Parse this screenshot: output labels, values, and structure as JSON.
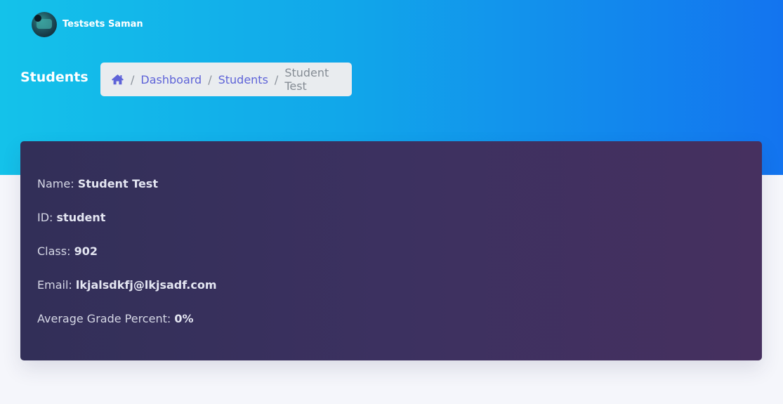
{
  "user": {
    "name": "Testsets Saman"
  },
  "page": {
    "title": "Students"
  },
  "breadcrumb": {
    "home_icon": "home-icon",
    "items": [
      {
        "label": "Dashboard"
      },
      {
        "label": "Students"
      }
    ],
    "current": "Student Test",
    "separator": "/"
  },
  "student": {
    "fields": [
      {
        "label": "Name:",
        "value": "Student Test"
      },
      {
        "label": "ID:",
        "value": "student"
      },
      {
        "label": "Class:",
        "value": "902"
      },
      {
        "label": "Email:",
        "value": "lkjalsdkfj@lkjsadf.com"
      },
      {
        "label": "Average Grade Percent:",
        "value": "0%"
      }
    ]
  },
  "colors": {
    "header_start": "#14c2ea",
    "header_end": "#1374ef",
    "card_start": "#322f58",
    "card_end": "#46305f",
    "link": "#5e63d8"
  }
}
